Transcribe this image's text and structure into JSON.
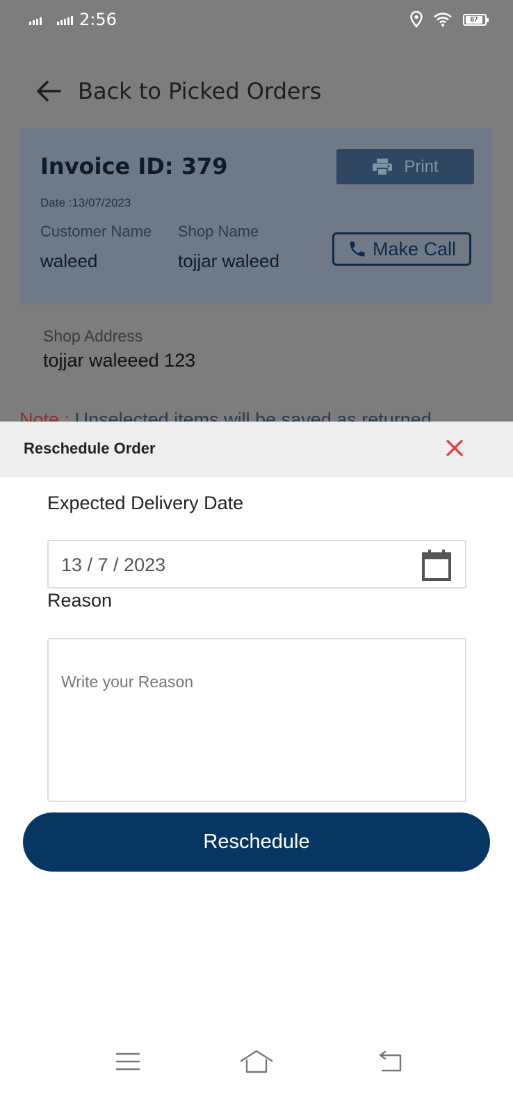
{
  "status_bar": {
    "time": "2:56",
    "battery": "67"
  },
  "header": {
    "back_label": "Back to Picked Orders"
  },
  "invoice": {
    "title": "Invoice ID:  379",
    "date": "Date :13/07/2023",
    "customer_label": "Customer Name",
    "customer_value": "waleed",
    "shop_label": "Shop Name",
    "shop_value": "tojjar waleed",
    "print_label": "Print",
    "call_label": "Make Call"
  },
  "address": {
    "label": "Shop Address",
    "value": "tojjar waleeed 123"
  },
  "note": {
    "prefix": "Note :",
    "text": "Unselected items will be saved as returned"
  },
  "modal": {
    "title": "Reschedule Order",
    "date_label": "Expected Delivery Date",
    "date_value": "13 / 7 / 2023",
    "reason_label": "Reason",
    "reason_placeholder": "Write your Reason",
    "submit_label": "Reschedule"
  },
  "colors": {
    "primary": "#063763",
    "close": "#e53935"
  }
}
